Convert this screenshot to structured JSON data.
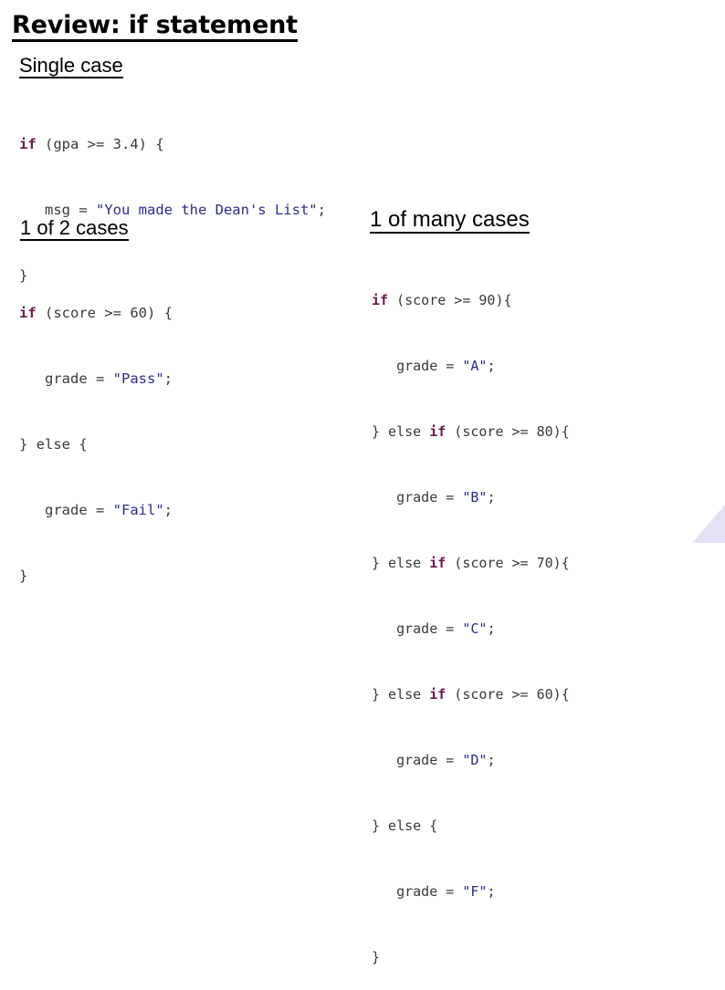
{
  "slide": {
    "title": "Review: if statement",
    "accent_color": "#e2e1f5",
    "keyword_color": "#6b1a4d",
    "string_color": "#2b2b8f",
    "code_color": "#3a3a3a"
  },
  "sections": {
    "single": {
      "heading": "Single case",
      "code": {
        "l1_kw": "if",
        "l1_rest": " (gpa >= 3.4) {",
        "l2_pre": "   msg = ",
        "l2_str": "\"You made the Dean's List\"",
        "l2_post": ";",
        "l3": "}"
      }
    },
    "two_cases": {
      "heading": "1 of 2 cases",
      "code": {
        "l1_kw": "if",
        "l1_rest": " (score >= 60) {",
        "l2_pre": "   grade = ",
        "l2_str": "\"Pass\"",
        "l2_post": ";",
        "l3": "} else {",
        "l4_pre": "   grade = ",
        "l4_str": "\"Fail\"",
        "l4_post": ";",
        "l5": "}"
      }
    },
    "many_cases": {
      "heading": "1 of many cases",
      "code": {
        "l1_kw": "if",
        "l1_rest": " (score >= 90){",
        "l2_pre": "   grade = ",
        "l2_str": "\"A\"",
        "l2_post": ";",
        "l3_pre": "} else ",
        "l3_kw": "if",
        "l3_rest": " (score >= 80){",
        "l4_pre": "   grade = ",
        "l4_str": "\"B\"",
        "l4_post": ";",
        "l5_pre": "} else ",
        "l5_kw": "if",
        "l5_rest": " (score >= 70){",
        "l6_pre": "   grade = ",
        "l6_str": "\"C\"",
        "l6_post": ";",
        "l7_pre": "} else ",
        "l7_kw": "if",
        "l7_rest": " (score >= 60){",
        "l8_pre": "   grade = ",
        "l8_str": "\"D\"",
        "l8_post": ";",
        "l9": "} else {",
        "l10_pre": "   grade = ",
        "l10_str": "\"F\"",
        "l10_post": ";",
        "l11": "}"
      }
    }
  }
}
